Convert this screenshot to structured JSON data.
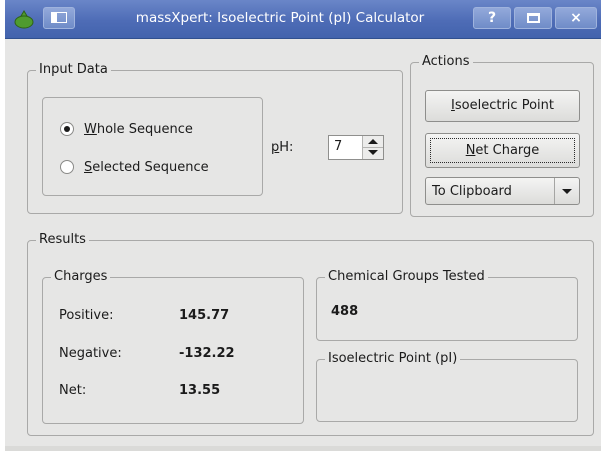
{
  "window": {
    "title": "massXpert: Isoelectric Point (pI) Calculator",
    "help_label": "?",
    "close_label": "×"
  },
  "input_data": {
    "legend": "Input Data",
    "whole_sequence": {
      "pre": "",
      "ul": "W",
      "post": "hole Sequence",
      "checked": true
    },
    "selected_sequence": {
      "pre": "",
      "ul": "S",
      "post": "elected Sequence",
      "checked": false
    },
    "ph_label": {
      "ul": "p",
      "post": "H:"
    },
    "ph_value": "7"
  },
  "actions": {
    "legend": "Actions",
    "isoelectric_button": {
      "ul": "I",
      "post": "soelectric Point"
    },
    "net_charge_button": {
      "ul": "N",
      "post": "et Charge"
    },
    "output_combo": "To Clipboard"
  },
  "results": {
    "legend": "Results",
    "charges": {
      "legend": "Charges",
      "positive_label": "Positive:",
      "positive_value": "145.77",
      "negative_label": "Negative:",
      "negative_value": "-132.22",
      "net_label": "Net:",
      "net_value": "13.55"
    },
    "chemical_groups": {
      "legend": "Chemical Groups Tested",
      "value": "488"
    },
    "isoelectric_point": {
      "legend": "Isoelectric Point (pI)",
      "value": ""
    }
  },
  "colors": {
    "titlebar": "#4e6cb6",
    "window_bg": "#e6e6e5",
    "app_icon": "#4f9b2f"
  }
}
